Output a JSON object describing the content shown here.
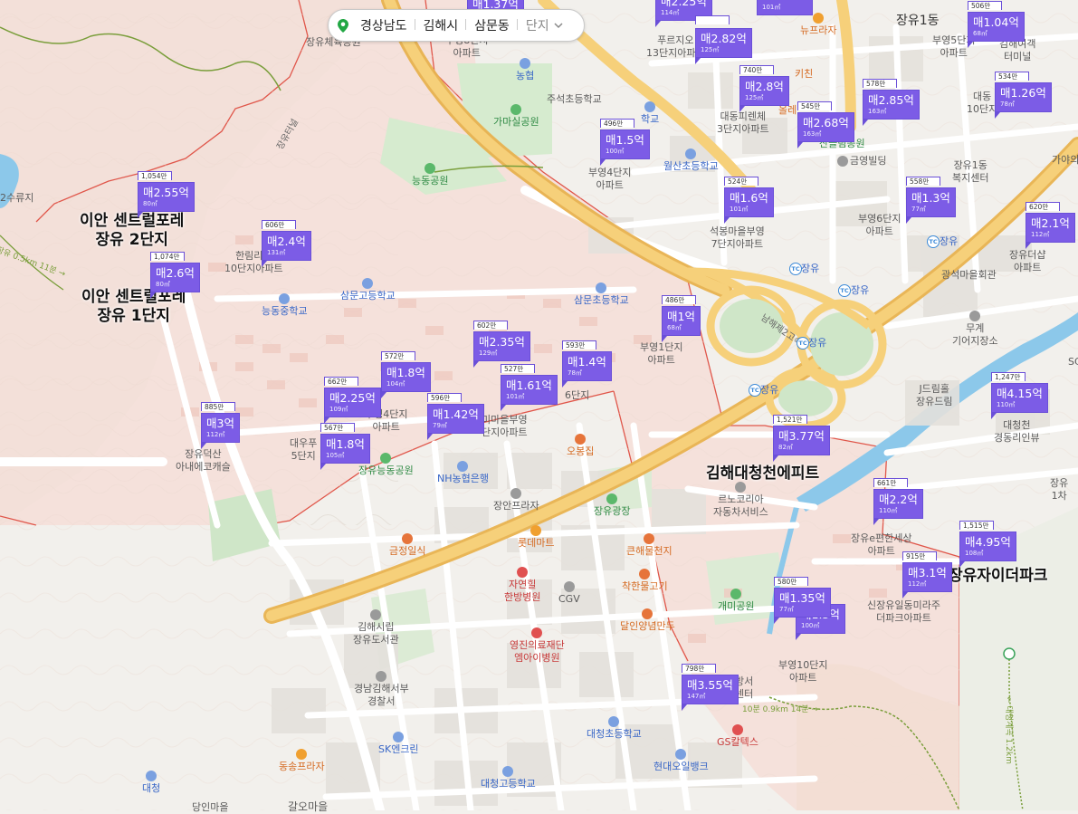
{
  "breadcrumb": {
    "province": "경상남도",
    "city": "김해시",
    "dong": "삼문동",
    "complex_label": "단지",
    "pin_icon": "location-pin-icon",
    "chevron_icon": "chevron-down-icon"
  },
  "colors": {
    "marker": "#7c5ce6",
    "marker_border": "#6a4fd8",
    "region_fill": "#f7dcd6",
    "region_border": "#e0564a",
    "highway": "#f2c96b",
    "water": "#8cc8ea",
    "park": "#cde8c6"
  },
  "markers": [
    {
      "id": "m01",
      "unit": "",
      "price": "매1.37억",
      "area": ""
    },
    {
      "id": "m02",
      "unit": "",
      "price": "매2.25억",
      "area": "114㎡"
    },
    {
      "id": "m03",
      "unit": "",
      "price": "",
      "area": "101㎡"
    },
    {
      "id": "m04",
      "unit": "506만",
      "price": "매1.04억",
      "area": "68㎡"
    },
    {
      "id": "m05",
      "unit": "",
      "price": "매2.82억",
      "area": "125㎡"
    },
    {
      "id": "m06",
      "unit": "740만",
      "price": "매2.8억",
      "area": "125㎡"
    },
    {
      "id": "m07",
      "unit": "578만",
      "price": "매2.85억",
      "area": "163㎡"
    },
    {
      "id": "m08",
      "unit": "534만",
      "price": "매1.26억",
      "area": "78㎡"
    },
    {
      "id": "m09",
      "unit": "545만",
      "price": "매2.68억",
      "area": "163㎡"
    },
    {
      "id": "m10",
      "unit": "496만",
      "price": "매1.5억",
      "area": "100㎡"
    },
    {
      "id": "m11",
      "unit": "524만",
      "price": "매1.6억",
      "area": "101㎡"
    },
    {
      "id": "m12",
      "unit": "558만",
      "price": "매1.3억",
      "area": "77㎡"
    },
    {
      "id": "m13",
      "unit": "620만",
      "price": "매2.1억",
      "area": "112㎡"
    },
    {
      "id": "m14",
      "unit": "1,054만",
      "price": "매2.55억",
      "area": "80㎡"
    },
    {
      "id": "m15",
      "unit": "606만",
      "price": "매2.4억",
      "area": "131㎡"
    },
    {
      "id": "m16",
      "unit": "1,074만",
      "price": "매2.6억",
      "area": "80㎡"
    },
    {
      "id": "m17",
      "unit": "486만",
      "price": "매1억",
      "area": "68㎡"
    },
    {
      "id": "m18",
      "unit": "602만",
      "price": "매2.35억",
      "area": "129㎡"
    },
    {
      "id": "m19",
      "unit": "593만",
      "price": "매1.4억",
      "area": "78㎡"
    },
    {
      "id": "m20",
      "unit": "572만",
      "price": "매1.8억",
      "area": "104㎡"
    },
    {
      "id": "m21",
      "unit": "527만",
      "price": "매1.61억",
      "area": "101㎡"
    },
    {
      "id": "m22",
      "unit": "662만",
      "price": "매2.25억",
      "area": "109㎡"
    },
    {
      "id": "m23",
      "unit": "596만",
      "price": "매1.42억",
      "area": "79㎡"
    },
    {
      "id": "m24",
      "unit": "885만",
      "price": "매3억",
      "area": "112㎡"
    },
    {
      "id": "m25",
      "unit": "567만",
      "price": "매1.8억",
      "area": "105㎡"
    },
    {
      "id": "m26",
      "unit": "1,247만",
      "price": "매4.15억",
      "area": "110㎡"
    },
    {
      "id": "m27",
      "unit": "1,521만",
      "price": "매3.77억",
      "area": "82㎡"
    },
    {
      "id": "m28",
      "unit": "661만",
      "price": "매2.2억",
      "area": "110㎡"
    },
    {
      "id": "m29",
      "unit": "1,515만",
      "price": "매4.95억",
      "area": "108㎡"
    },
    {
      "id": "m30",
      "unit": "915만",
      "price": "매3.1억",
      "area": "112㎡"
    },
    {
      "id": "m31",
      "unit": "580만",
      "price": "매1.35억",
      "area": "77㎡"
    },
    {
      "id": "m32",
      "unit": "",
      "price": "매1.5억",
      "area": "100㎡"
    },
    {
      "id": "m33",
      "unit": "798만",
      "price": "매3.55억",
      "area": "147㎡"
    }
  ],
  "complex_labels": {
    "ian_2": "이안 센트럴포레\n장유 2단지",
    "ian_1": "이안 센트럴포레\n장유 1단지",
    "gimhae_daecheong": "김해대청천에피트",
    "jangyu_xi": "장유자이더파크"
  },
  "pois": {
    "jangyu_gym": "장유체육공원",
    "buyeong8": "부영8단지\n아파트",
    "nonghyup": "농협",
    "jusuk_school": "주석초등학교",
    "gamasil_park": "가마실공원",
    "neungdong_park": "능동공원",
    "jangyu_tunnel": "장유터널",
    "puruji": "푸르지오\n13단지아파트",
    "daedong_1": "대동피렌체\n3단지아파트",
    "buyeong4": "부영4단지\n아파트",
    "wolsan_school": "월산초등학교",
    "school_mid": "학교",
    "olle": "올레",
    "chaegwon_kichen": "키친",
    "ssannang": "산들림공원",
    "neulbit": "금영빌딩",
    "seokbong": "석봉마을부영\n7단지아파트",
    "buyeong6": "부영6단지\n아파트",
    "jangyu1dong": "장유1동",
    "jangyu1_welfare": "장유1동\n복지센터",
    "buyeong5": "부영5단지\n아파트",
    "gimhae_terminal": "김해여객\n터미널",
    "daedong_10": "대동\n10단지",
    "newplaza": "뉴프라자",
    "gwangseok": "광석마을회관",
    "jangyu_deosan": "장유더샵\n아파트",
    "gayaui": "가야의",
    "hanrim": "한림리젠\n10단지아파트",
    "samun_high": "삼문고등학교",
    "neungdong_mid": "능동중학교",
    "samun_school": "삼문초등학교",
    "buyeong1": "부영1단지\n아파트",
    "buyeong6b": "6단지",
    "buyeong4b": "부영4단지\n아파트",
    "bumi_buyeong": "미마을부영\n단지아파트",
    "daewoo": "대우푸\n5단지",
    "jangyu_deoksan": "장유덕산\n아내에코캐슬",
    "jangyu_neungdong_park": "장유능동공원",
    "nh_bank": "NH농협은행",
    "obongjip": "오봉집",
    "jangan_plaza": "장안프라자",
    "jangyu_square": "장유광장",
    "lotte_mart": "롯데마트",
    "geumjeong": "금정일식",
    "keunhae": "큰해물천지",
    "jayeon_hospital": "자연힐\n한방병원",
    "cgv": "CGV",
    "jakhan": "착한물고기",
    "dalin": "달인양념만두",
    "youngjin_hospital": "영진의료재단\n엠아이병원",
    "gimhae_library": "김해시립\n장유도서관",
    "gyeongnam_police": "경남김해서부\n경찰서",
    "sk_engine": "SK엔크린",
    "dongsong": "동송프라자",
    "daecheong_station": "대청",
    "daecheong_high": "대청고등학교",
    "daecheong_school": "대청초등학교",
    "hyundai_bank": "현대오일뱅크",
    "gs_caltex": "GS칼텍스",
    "lenocorea": "르노코리아\n자동차서비스",
    "gaemi_park": "개미공원",
    "buyeong10": "부영10단지\n아파트",
    "bangseo": "방서\n센터",
    "sinjangyu": "신장유일동미라주\n더파크아파트",
    "jangyu_epyeon": "장유e편한세상\n아파트",
    "mugye": "무계\n기어지장소",
    "jdream": "J드림홀\n장유드림",
    "daecheong_river": "대청천\n경동리인뷰",
    "jangyu_1cha": "장유\n1차",
    "sc": "SC",
    "jangyu_tc": "장유",
    "jangyu_tc2": "장유",
    "jangyu_tc3": "장유",
    "jangyu_tc4": "장유",
    "jangyu_tc5": "장유",
    "jangyu_2_suryu": "2수류지",
    "namhae2": "남해제2고속",
    "gwanaksi": "가야의",
    "baegong_hall": "갈오마을",
    "dongmyeong": "당인마을"
  },
  "road_labels": {
    "trail_left": "장유 0.5km 11분 →",
    "trail_bottom": "10분 0.9km 14분 →",
    "trail_right": "← 대청계곡 1.2km"
  }
}
